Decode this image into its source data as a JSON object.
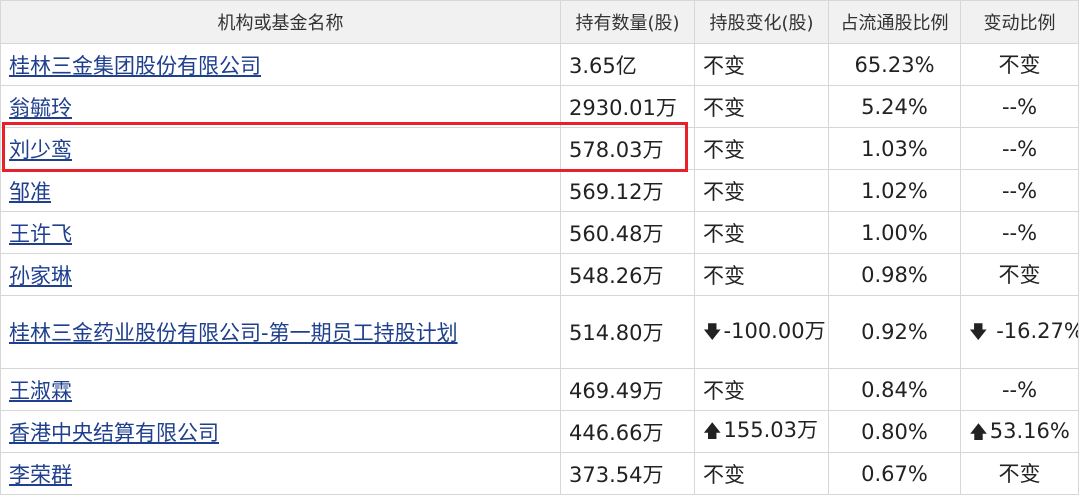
{
  "header": {
    "name": "机构或基金名称",
    "quantity": "持有数量(股)",
    "change": "持股变化(股)",
    "ratio": "占流通股比例",
    "change_rate": "变动比例"
  },
  "rows": [
    {
      "name": "桂林三金集团股份有限公司",
      "quantity": "3.65亿",
      "change": "不变",
      "ratio": "65.23%",
      "change_rate": "不变"
    },
    {
      "name": "翁毓玲",
      "quantity": "2930.01万",
      "change": "不变",
      "ratio": "5.24%",
      "change_rate": "--%"
    },
    {
      "name": "刘少鸾",
      "quantity": "578.03万",
      "change": "不变",
      "ratio": "1.03%",
      "change_rate": "--%"
    },
    {
      "name": "邹准",
      "quantity": "569.12万",
      "change": "不变",
      "ratio": "1.02%",
      "change_rate": "--%"
    },
    {
      "name": "王许飞",
      "quantity": "560.48万",
      "change": "不变",
      "ratio": "1.00%",
      "change_rate": "--%"
    },
    {
      "name": "孙家琳",
      "quantity": "548.26万",
      "change": "不变",
      "ratio": "0.98%",
      "change_rate": "不变"
    },
    {
      "name": "桂林三金药业股份有限公司-第一期员工持股计划",
      "quantity": "514.80万",
      "change": "-100.00万",
      "ratio": "0.92%",
      "change_rate": "-16.27%"
    },
    {
      "name": "王淑霖",
      "quantity": "469.49万",
      "change": "不变",
      "ratio": "0.84%",
      "change_rate": "--%"
    },
    {
      "name": "香港中央结算有限公司",
      "quantity": "446.66万",
      "change": "155.03万",
      "ratio": "0.80%",
      "change_rate": "53.16%"
    },
    {
      "name": "李荣群",
      "quantity": "373.54万",
      "change": "不变",
      "ratio": "0.67%",
      "change_rate": "不变"
    }
  ],
  "icons": {
    "down": "down-arrow-icon",
    "up": "up-arrow-icon"
  },
  "colors": {
    "link": "#1f3f8f",
    "decrease": "#3c9a16",
    "increase": "#d41818",
    "highlight": "#e8202a",
    "header_bg": "#f1f1f1"
  }
}
